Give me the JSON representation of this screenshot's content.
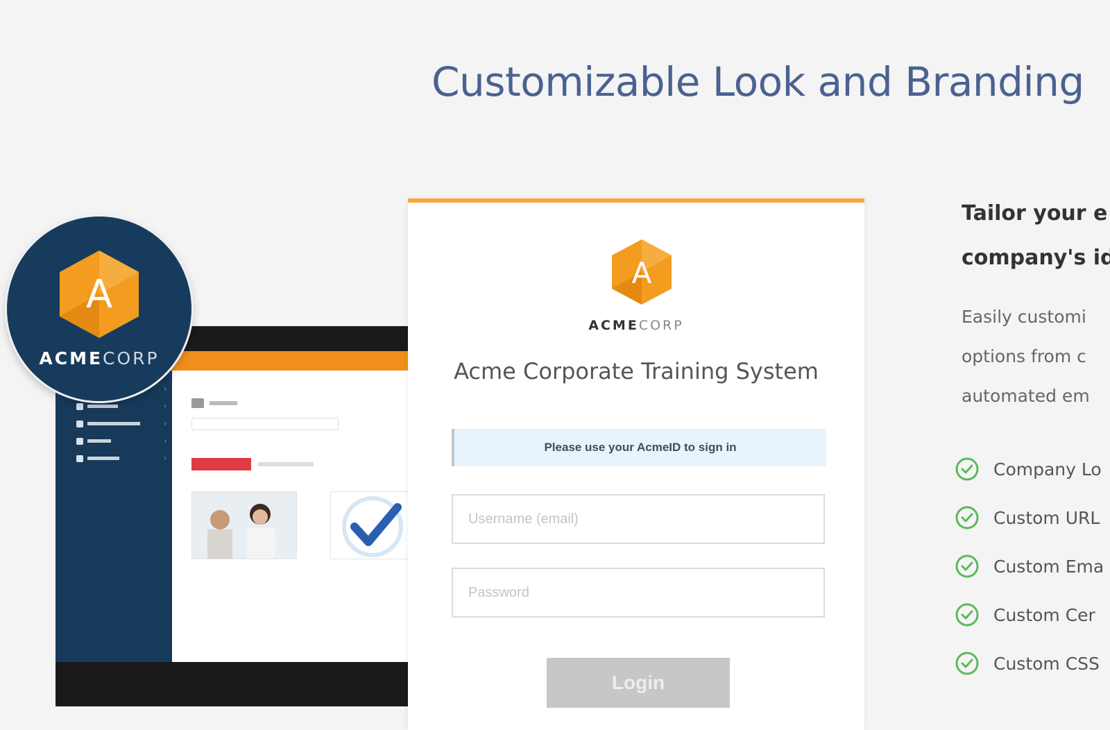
{
  "header": {
    "title": "Customizable Look and Branding"
  },
  "brand": {
    "name_bold": "ACME",
    "name_light": "CORP",
    "logo_letter": "A",
    "colors": {
      "orange": "#f39c1f",
      "navy": "#173b5d",
      "title_blue": "#4a6290"
    }
  },
  "login": {
    "system_title": "Acme Corporate Training System",
    "notice": "Please use your AcmeID to sign in",
    "username_placeholder": "Username (email)",
    "password_placeholder": "Password",
    "login_button": "Login"
  },
  "info": {
    "heading_line1": "Tailor your e",
    "heading_line2": "company's id",
    "desc_line1": "Easily customi",
    "desc_line2": "options from c",
    "desc_line3": "automated em",
    "features": [
      {
        "label": "Company Lo",
        "icon": "check-circle-icon"
      },
      {
        "label": "Custom URL",
        "icon": "check-circle-icon"
      },
      {
        "label": "Custom Ema",
        "icon": "check-circle-icon"
      },
      {
        "label": "Custom Cer",
        "icon": "check-circle-icon"
      },
      {
        "label": "Custom CSS",
        "icon": "check-circle-icon"
      }
    ]
  }
}
